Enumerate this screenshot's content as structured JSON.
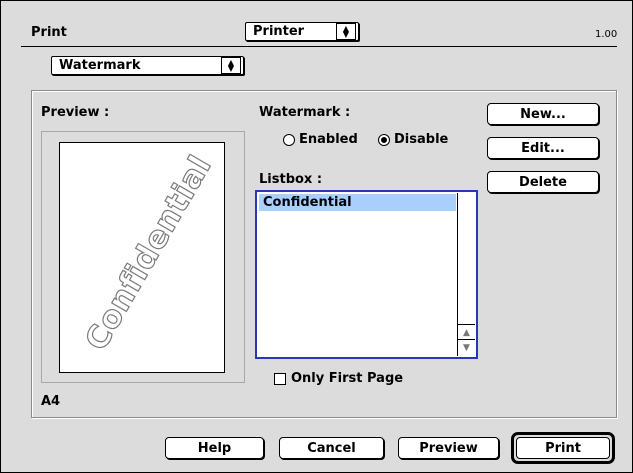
{
  "header": {
    "title": "Print",
    "printer_popup": "Printer",
    "version": "1.00"
  },
  "panel_popup": "Watermark",
  "preview": {
    "label": "Preview :",
    "watermark_text": "Confidential",
    "paper_size": "A4"
  },
  "watermark": {
    "label": "Watermark :",
    "options": [
      {
        "label": "Enabled",
        "selected": false
      },
      {
        "label": "Disable",
        "selected": true
      }
    ]
  },
  "listbox": {
    "label": "Listbox :",
    "items": [
      "Confidential"
    ],
    "selected_index": 0
  },
  "only_first_page": {
    "label": "Only First Page",
    "checked": false
  },
  "side_buttons": {
    "new": "New...",
    "edit": "Edit...",
    "delete": "Delete"
  },
  "footer_buttons": {
    "help": "Help",
    "cancel": "Cancel",
    "preview": "Preview",
    "print": "Print"
  },
  "colors": {
    "selection": "#a9cfff",
    "focus_ring": "#2a36b6",
    "background": "#dcdcdc"
  }
}
